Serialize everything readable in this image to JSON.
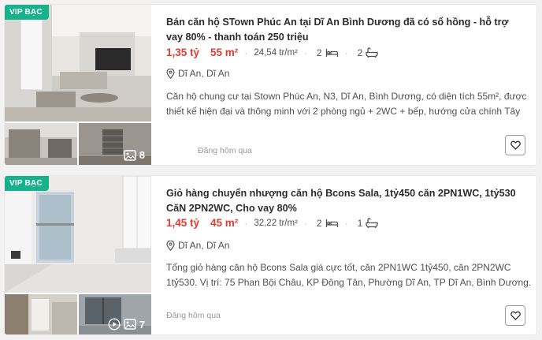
{
  "listings": [
    {
      "badge": "VIP BẠC",
      "title": "Bán căn hộ STown Phúc An tại Dĩ An Bình Dương đã có sổ hồng - hỗ trợ vay 80% - thanh toán 250 triệu",
      "price": "1,35 tỷ",
      "area": "55 m²",
      "price_per_m2": "24,54 tr/m²",
      "bedrooms": "2",
      "bathrooms": "2",
      "location": "Dĩ An, Dĩ An",
      "description": "Căn hộ chung cư tại Stown Phúc An, N3, Dĩ An, Bình Dương, có diện tích 55m², được thiết kế hiện đại và thông minh với 2 phòng ngủ + 2WC + bếp, hướng cửa chính Tây và ban công...",
      "posted": "Đăng hôm qua",
      "photo_count": "8",
      "icons": [
        "bed-icon",
        "bath-icon",
        "location-pin-icon",
        "image-icon",
        "heart-icon"
      ]
    },
    {
      "badge": "VIP BẠC",
      "title": "Giỏ hàng chuyển nhượng căn hộ Bcons Sala, 1tỷ450 căn 2PN1WC, 1tỷ530 CăN 2PN2WC, Cho vay 80%",
      "price": "1,45 tỷ",
      "area": "45 m²",
      "price_per_m2": "32,22 tr/m²",
      "bedrooms": "2",
      "bathrooms": "1",
      "location": "Dĩ An, Dĩ An",
      "description": "Tổng giỏ hàng căn hộ Bcons Sala giá cực tốt, căn 2PN1WC 1tỷ450, căn 2PN2WC 1tỷ530. Vị trí: 75 Phan Bội Châu, KP Đông Tân, Phường Dĩ An, TP Dĩ An, Bình Dương. Cập nhật bảng g...",
      "posted": "Đăng hôm qua",
      "photo_count": "7",
      "icons": [
        "bed-icon",
        "bath-icon",
        "location-pin-icon",
        "play-icon",
        "image-icon",
        "heart-icon"
      ]
    }
  ],
  "colors": {
    "accent_red": "#e03c31",
    "vip_green": "#17b28b"
  }
}
